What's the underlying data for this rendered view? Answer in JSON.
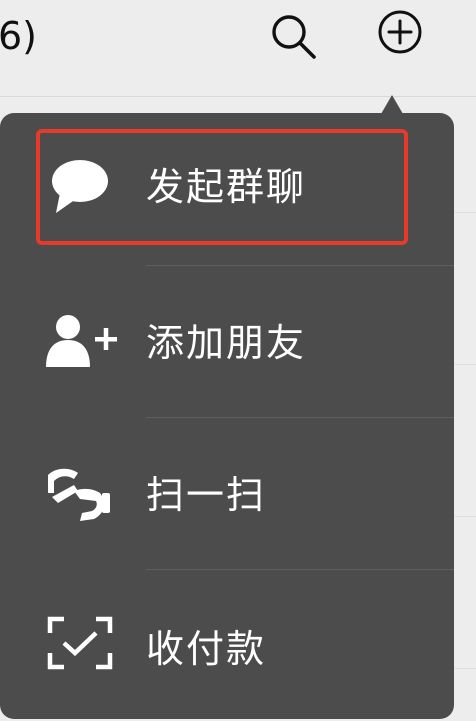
{
  "header": {
    "title_fragment": "6)",
    "search_icon": "search-icon",
    "add_icon": "plus-circle-icon"
  },
  "menu": {
    "items": [
      {
        "label": "发起群聊",
        "icon": "chat-bubble-icon"
      },
      {
        "label": "添加朋友",
        "icon": "add-friend-icon"
      },
      {
        "label": "扫一扫",
        "icon": "scan-icon"
      },
      {
        "label": "收付款",
        "icon": "pay-scan-icon"
      }
    ]
  },
  "colors": {
    "menu_background": "#4c4c4c",
    "highlight_border": "#e83a2a",
    "page_background": "#ededed"
  }
}
